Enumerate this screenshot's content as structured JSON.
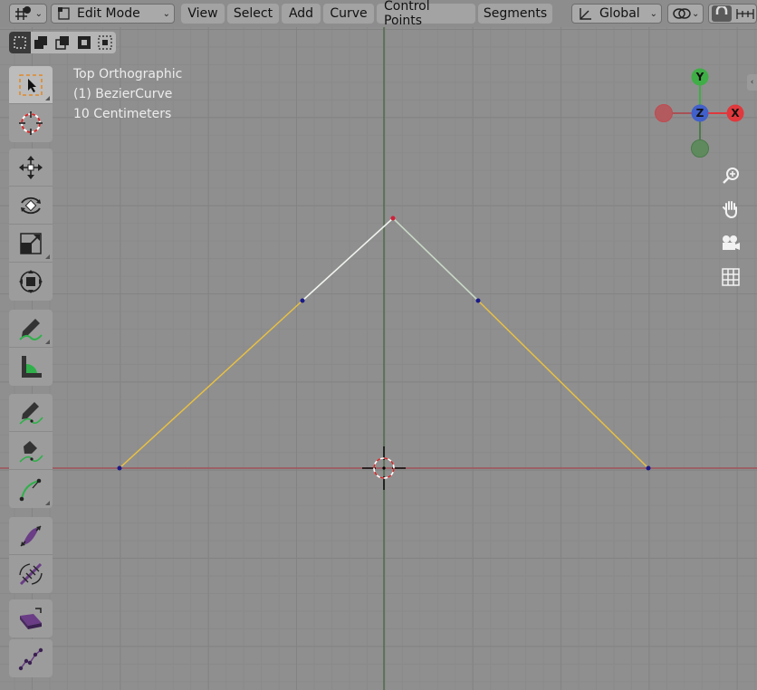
{
  "header": {
    "mode_label": "Edit Mode",
    "menus": [
      "View",
      "Select",
      "Add",
      "Curve",
      "Control Points",
      "Segments"
    ],
    "transform_orientation": "Global"
  },
  "select_modes": [
    "set",
    "extend",
    "subtract",
    "difference",
    "intersect"
  ],
  "overlay": {
    "view_name": "Top Orthographic",
    "object_name": "(1) BezierCurve",
    "grid_scale": "10 Centimeters"
  },
  "gizmo": {
    "x_label": "X",
    "y_label": "Y",
    "z_label": "Z"
  },
  "toolbar": {
    "groups": [
      [
        "select-box",
        "cursor"
      ],
      [
        "move",
        "rotate",
        "scale",
        "transform"
      ],
      [
        "annotate",
        "measure"
      ],
      [
        "draw",
        "pen",
        "curve-pen"
      ],
      [
        "tilt",
        "radius"
      ],
      [
        "extrude"
      ],
      [
        "randomize"
      ]
    ]
  },
  "colors": {
    "viewport_bg": "#8f8f8f",
    "curve_segment": "#e8c043",
    "handle_segment": "#d9e6d6",
    "axis_x": "#b3474f",
    "axis_y": "#4f7a45",
    "gizmo_x": "#e0383c",
    "gizmo_y": "#3fae46",
    "gizmo_z": "#4260c9"
  }
}
